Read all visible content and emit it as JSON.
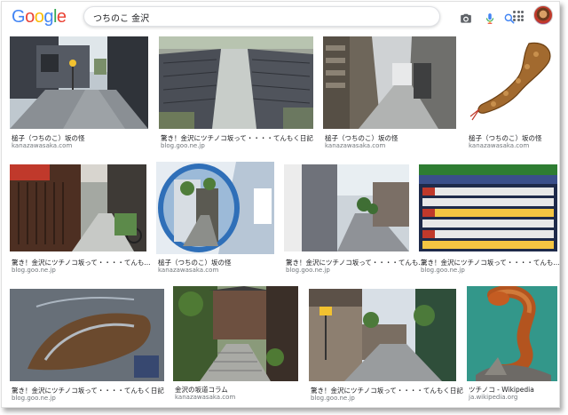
{
  "app": {
    "logo": [
      "G",
      "o",
      "o",
      "g",
      "l",
      "e"
    ],
    "logo_colors": [
      "#4285F4",
      "#EA4335",
      "#FBBC05",
      "#4285F4",
      "#34A853",
      "#EA4335"
    ]
  },
  "search": {
    "query": "つちのこ 金沢"
  },
  "icons": {
    "camera": "camera-icon",
    "mic": "microphone-icon",
    "search": "search-icon",
    "apps": "apps-grid-icon"
  },
  "results": [
    {
      "title": "槌子（つちのこ）坂の怪",
      "source": "kanazawasaka.com"
    },
    {
      "title": "驚き！金沢にツチノコ坂って・・・・てんもく日記",
      "source": "blog.goo.ne.jp"
    },
    {
      "title": "槌子（つちのこ）坂の怪",
      "source": "kanazawasaka.com"
    },
    {
      "title": "槌子（つちのこ）坂の怪",
      "source": "kanazawasaka.com"
    },
    {
      "title": "驚き！金沢にツチノコ坂って・・・・てんも...",
      "source": "blog.goo.ne.jp"
    },
    {
      "title": "槌子（つちのこ）坂の怪",
      "source": "kanazawasaka.com"
    },
    {
      "title": "驚き！金沢にツチノコ坂って・・・・てんも...",
      "source": "blog.goo.ne.jp"
    },
    {
      "title": "驚き！金沢にツチノコ坂って・・・・てんも...",
      "source": "blog.goo.ne.jp"
    },
    {
      "title": "驚き！金沢にツチノコ坂って・・・・てんもく日記",
      "source": "blog.goo.ne.jp"
    },
    {
      "title": "金沢の坂道コラム",
      "source": "kanazawasaka.com"
    },
    {
      "title": "驚き！金沢にツチノコ坂って・・・・てんもく日記",
      "source": "blog.goo.ne.jp"
    },
    {
      "title": "ツチノコ - Wikipedia",
      "source": "ja.wikipedia.org"
    }
  ]
}
